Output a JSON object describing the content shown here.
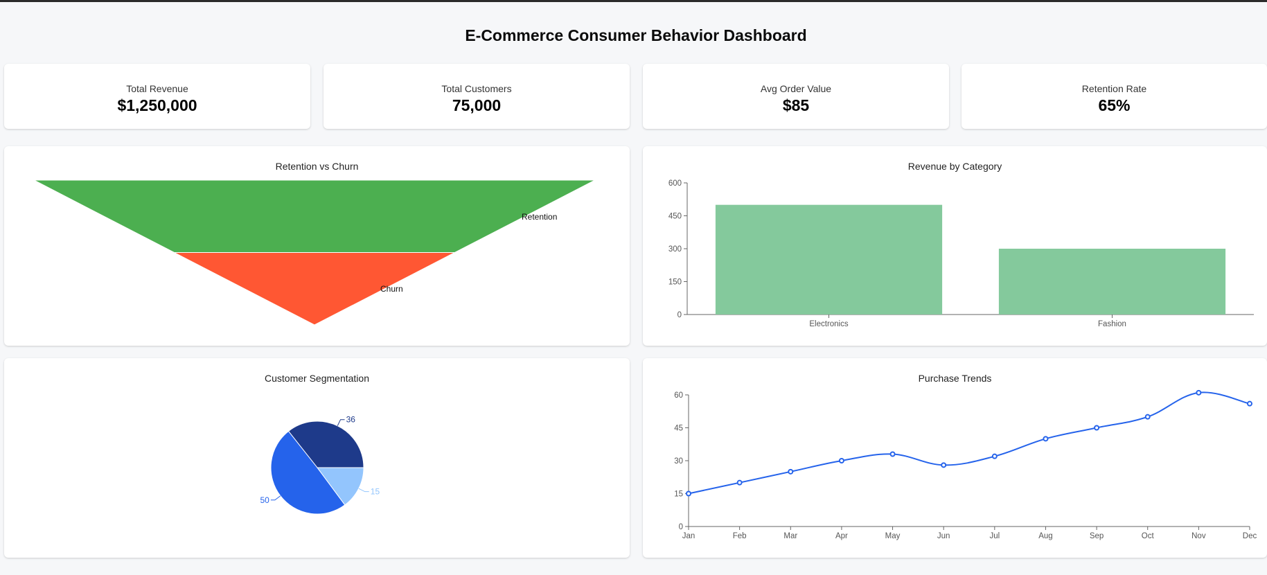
{
  "page_title": "E-Commerce Consumer Behavior Dashboard",
  "kpis": [
    {
      "label": "Total Revenue",
      "value": "$1,250,000"
    },
    {
      "label": "Total Customers",
      "value": "75,000"
    },
    {
      "label": "Avg Order Value",
      "value": "$85"
    },
    {
      "label": "Retention Rate",
      "value": "65%"
    }
  ],
  "colors": {
    "retention": "#4caf50",
    "churn": "#ff5733",
    "bar": "#84c99c",
    "line": "#2563eb",
    "pie": [
      "#1e3a8a",
      "#2563eb",
      "#93c5fd"
    ]
  },
  "chart_data": [
    {
      "type": "funnel",
      "title": "Retention vs Churn",
      "categories": [
        "Retention",
        "Churn"
      ]
    },
    {
      "type": "bar",
      "title": "Revenue by Category",
      "categories": [
        "Electronics",
        "Fashion"
      ],
      "values": [
        500,
        300
      ],
      "ylim": [
        0,
        600
      ],
      "yticks": [
        0,
        150,
        300,
        450,
        600
      ],
      "grid": false
    },
    {
      "type": "pie",
      "title": "Customer Segmentation",
      "values": [
        36,
        50,
        15
      ]
    },
    {
      "type": "line",
      "title": "Purchase Trends",
      "categories": [
        "Jan",
        "Feb",
        "Mar",
        "Apr",
        "May",
        "Jun",
        "Jul",
        "Aug",
        "Sep",
        "Oct",
        "Nov",
        "Dec"
      ],
      "values": [
        15,
        20,
        25,
        30,
        33,
        28,
        32,
        40,
        45,
        50,
        61,
        56
      ],
      "ylim": [
        0,
        60
      ],
      "yticks": [
        0,
        15,
        30,
        45,
        60
      ],
      "grid": false
    }
  ]
}
